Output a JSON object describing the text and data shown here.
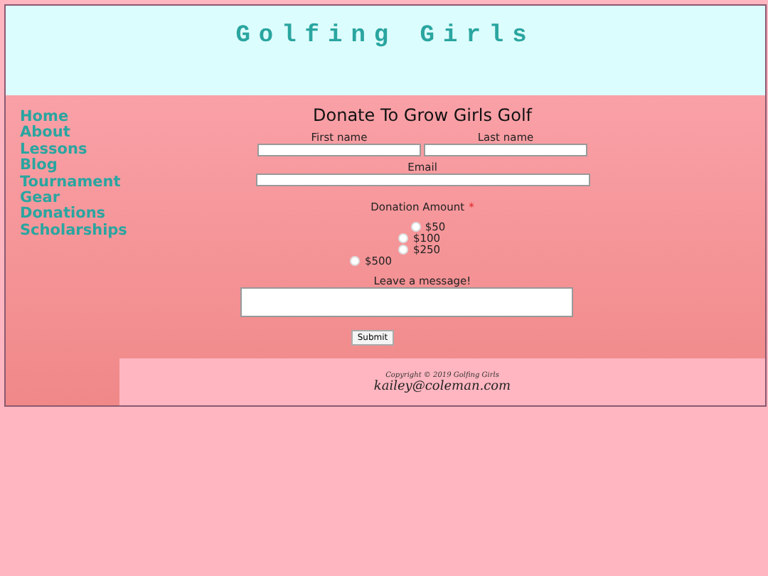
{
  "header": {
    "title": "Golfing Girls"
  },
  "nav": [
    "Home",
    "About",
    "Lessons",
    "Blog",
    "Tournament",
    "Gear",
    "Donations",
    "Scholarships"
  ],
  "form": {
    "title": "Donate To Grow Girls Golf",
    "first_name_label": "First name",
    "last_name_label": "Last name",
    "email_label": "Email",
    "amount_label": "Donation Amount",
    "required_mark": "*",
    "amounts": [
      {
        "label": "$50",
        "selected": false
      },
      {
        "label": "$100",
        "selected": false
      },
      {
        "label": "$250",
        "selected": false
      },
      {
        "label": "$500",
        "selected": false
      }
    ],
    "message_label": "Leave a message!",
    "submit": "Submit"
  },
  "footer": {
    "copyright": "Copyright © 2019 Golfing Girls",
    "email": "kailey@coleman.com"
  }
}
